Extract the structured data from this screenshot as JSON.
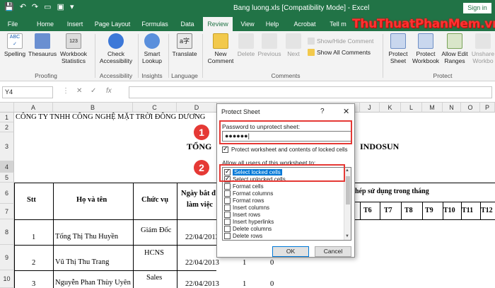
{
  "titlebar": {
    "doc_title": "Bang luong.xls  [Compatibility Mode]  -  Excel",
    "signin": "Sign in"
  },
  "tabs": [
    "File",
    "Home",
    "Insert",
    "Page Layout",
    "Formulas",
    "Data",
    "Review",
    "View",
    "Help",
    "Acrobat",
    "Tell m"
  ],
  "active_tab": "Review",
  "watermark": {
    "part1": "ThuThuat",
    "part2": "PhanMem",
    "part3": ".vn"
  },
  "ribbon": {
    "proofing": {
      "spelling": "Spelling",
      "thesaurus": "Thesaurus",
      "workbook": "Workbook",
      "statistics": "Statistics",
      "group": "Proofing"
    },
    "accessibility": {
      "check": "Check",
      "accessibility": "Accessibility",
      "group": "Accessibility"
    },
    "insights": {
      "smart": "Smart",
      "lookup": "Lookup",
      "group": "Insights"
    },
    "language": {
      "translate": "Translate",
      "group": "Language"
    },
    "comments": {
      "new": "New",
      "comment": "Comment",
      "delete": "Delete",
      "previous": "Previous",
      "next": "Next",
      "show_hide": "Show/Hide Comment",
      "show_all": "Show All Comments",
      "group": "Comments"
    },
    "protect": {
      "protect1": "Protect",
      "sheet": "Sheet",
      "protect2": "Protect",
      "workbook": "Workbook",
      "allow": "Allow Edit",
      "ranges": "Ranges",
      "unshare": "Unshare",
      "workbook2": "Workbo",
      "group": "Protect"
    }
  },
  "formula_bar": {
    "name_box": "Y4",
    "fx": "fx"
  },
  "columns": [
    "A",
    "B",
    "C",
    "D",
    "E",
    "F",
    "G",
    "H",
    "I",
    "J",
    "K",
    "L",
    "M",
    "N",
    "O",
    "P",
    "Q"
  ],
  "rows": [
    "1",
    "2",
    "3",
    "4",
    "5",
    "6",
    "7",
    "8",
    "9",
    "10"
  ],
  "sheet": {
    "company": "CÔNG TY TNHH CÔNG NGHỆ MẶT TRỜI ĐÔNG DƯƠNG",
    "title_left": "TỔNG",
    "title_right": "INDOSUN",
    "h_stt": "Stt",
    "h_name": "Họ và tên",
    "h_role": "Chức vụ",
    "h_start1": "Ngày bắt đ",
    "h_start2": "làm việc",
    "h_usage": "hép sử dụng trong tháng",
    "t6": "T6",
    "t7": "T7",
    "t8": "T8",
    "t9": "T9",
    "t10": "T10",
    "t11": "T11",
    "t12": "T12",
    "r1": {
      "stt": "1",
      "name": "Tống Thị Thu Huyền",
      "role": "Giám Đốc",
      "date": "22/04/2013"
    },
    "r2": {
      "stt": "2",
      "name": "Vũ Thị Thu Trang",
      "role": "HCNS",
      "date": "22/04/2013",
      "v1": "1",
      "v2": "0"
    },
    "r3": {
      "stt": "3",
      "name": "Nguyễn Phan Thùy Uyên",
      "role": "Sales",
      "date": "22/04/2013",
      "v1": "1",
      "v2": "0"
    }
  },
  "dialog": {
    "title": "Protect Sheet",
    "help": "?",
    "close": "✕",
    "password_label": "Password to unprotect sheet:",
    "password_value": "●●●●●●|",
    "protect_option": "Protect worksheet and contents of locked cells",
    "allow_label": "Allow all users of this worksheet to:",
    "options": [
      {
        "label": "Select locked cells",
        "checked": true
      },
      {
        "label": "Select unlocked cells",
        "checked": true
      },
      {
        "label": "Format cells",
        "checked": false
      },
      {
        "label": "Format columns",
        "checked": false
      },
      {
        "label": "Format rows",
        "checked": false
      },
      {
        "label": "Insert columns",
        "checked": false
      },
      {
        "label": "Insert rows",
        "checked": false
      },
      {
        "label": "Insert hyperlinks",
        "checked": false
      },
      {
        "label": "Delete columns",
        "checked": false
      },
      {
        "label": "Delete rows",
        "checked": false
      }
    ],
    "ok": "OK",
    "cancel": "Cancel"
  },
  "badges": {
    "one": "1",
    "two": "2"
  },
  "colors": {
    "excel_green": "#217346",
    "highlight_red": "#e53935",
    "selection_blue": "#0078d7"
  }
}
